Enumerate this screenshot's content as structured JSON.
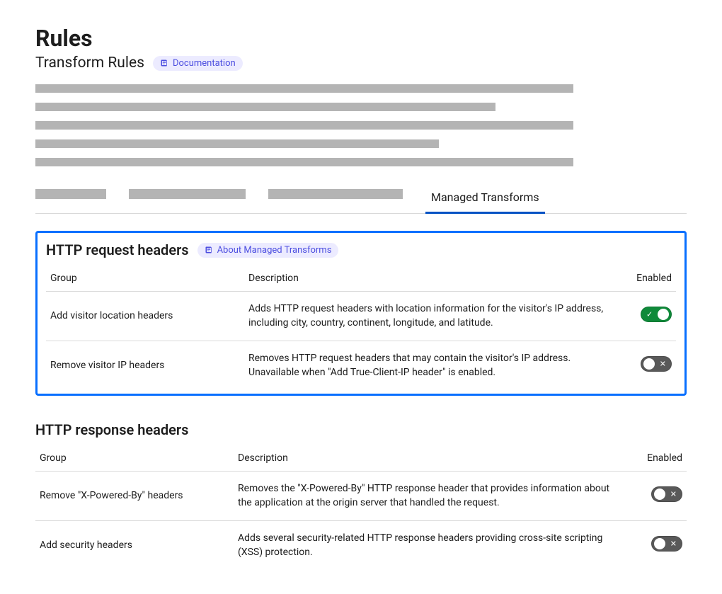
{
  "header": {
    "page_title": "Rules",
    "subtitle": "Transform Rules",
    "doc_link_label": "Documentation"
  },
  "tabs": {
    "active_label": "Managed Transforms"
  },
  "request_section": {
    "title": "HTTP request headers",
    "about_link_label": "About Managed Transforms",
    "columns": {
      "group": "Group",
      "description": "Description",
      "enabled": "Enabled"
    },
    "rows": [
      {
        "group": "Add visitor location headers",
        "description": "Adds HTTP request headers with location information for the visitor's IP address, including city, country, continent, longitude, and latitude.",
        "enabled": true
      },
      {
        "group": "Remove visitor IP headers",
        "description": "Removes HTTP request headers that may contain the visitor's IP address. Unavailable when \"Add True-Client-IP header\" is enabled.",
        "enabled": false
      }
    ]
  },
  "response_section": {
    "title": "HTTP response headers",
    "columns": {
      "group": "Group",
      "description": "Description",
      "enabled": "Enabled"
    },
    "rows": [
      {
        "group": "Remove \"X-Powered-By\" headers",
        "description": "Removes the \"X-Powered-By\" HTTP response header that provides information about the application at the origin server that handled the request.",
        "enabled": false
      },
      {
        "group": "Add security headers",
        "description": "Adds several security-related HTTP response headers providing cross-site scripting (XSS) protection.",
        "enabled": false
      }
    ]
  }
}
